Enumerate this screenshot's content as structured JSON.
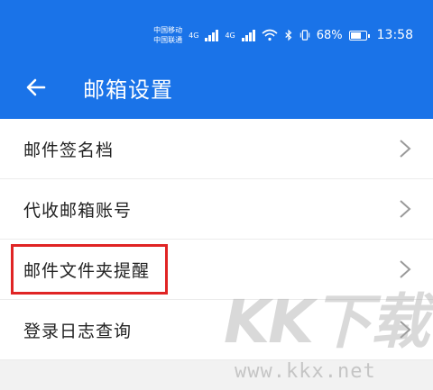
{
  "status_bar": {
    "carrier_1": "中国移动",
    "carrier_2": "中国联通",
    "signal_1": "4G",
    "signal_2": "4G",
    "battery": "68%",
    "battery_level": 0.68,
    "time": "13:58",
    "icons": [
      "signal-icon",
      "wifi-icon",
      "bluetooth-icon",
      "vibrate-icon",
      "battery-icon"
    ]
  },
  "header": {
    "title": "邮箱设置",
    "back_icon": "arrow-left-icon"
  },
  "settings_list": [
    {
      "label": "邮件签名档"
    },
    {
      "label": "代收邮箱账号"
    },
    {
      "label": "邮件文件夹提醒"
    },
    {
      "label": "登录日志查询"
    }
  ],
  "watermark": {
    "logo": "KK下载",
    "url": "www.kkx.net"
  },
  "colors": {
    "header_bg": "#1a73e8",
    "highlight": "#e02424",
    "text": "#222222"
  }
}
